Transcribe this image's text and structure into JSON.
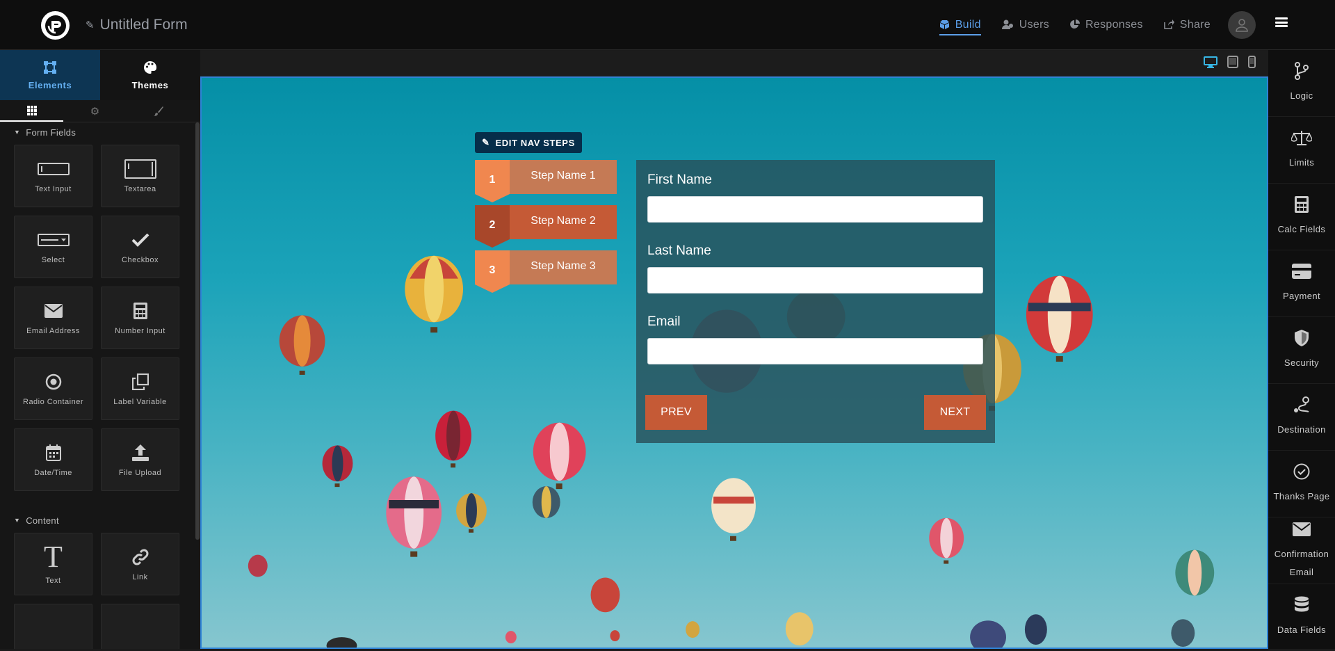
{
  "header": {
    "form_title": "Untitled Form",
    "nav": [
      {
        "label": "Build",
        "icon": "cubes-icon",
        "active": true
      },
      {
        "label": "Users",
        "icon": "users-icon",
        "active": false
      },
      {
        "label": "Responses",
        "icon": "pie-chart-icon",
        "active": false
      },
      {
        "label": "Share",
        "icon": "share-icon",
        "active": false
      }
    ]
  },
  "left_panel": {
    "tabs": [
      {
        "label": "Elements",
        "icon": "vector-square-icon",
        "active": true
      },
      {
        "label": "Themes",
        "icon": "palette-icon",
        "active": false
      }
    ],
    "subtabs": [
      "grid-icon",
      "gear-icon",
      "brush-icon"
    ],
    "sections": [
      {
        "title": "Form Fields",
        "items": [
          {
            "label": "Text Input",
            "icon": "text-input-icon"
          },
          {
            "label": "Textarea",
            "icon": "textarea-icon"
          },
          {
            "label": "Select",
            "icon": "select-icon"
          },
          {
            "label": "Checkbox",
            "icon": "check-icon"
          },
          {
            "label": "Email Address",
            "icon": "envelope-icon"
          },
          {
            "label": "Number Input",
            "icon": "calculator-icon"
          },
          {
            "label": "Radio Container",
            "icon": "radio-icon"
          },
          {
            "label": "Label Variable",
            "icon": "clone-icon"
          },
          {
            "label": "Date/Time",
            "icon": "calendar-icon"
          },
          {
            "label": "File Upload",
            "icon": "upload-icon"
          }
        ]
      },
      {
        "title": "Content",
        "items": [
          {
            "label": "Text",
            "icon": "text-icon"
          },
          {
            "label": "Link",
            "icon": "link-icon"
          }
        ]
      }
    ]
  },
  "canvas": {
    "edit_nav_label": "EDIT NAV STEPS",
    "steps": [
      {
        "number": "1",
        "label": "Step Name 1",
        "num_color": "#f0874f",
        "label_color": "#c57a55"
      },
      {
        "number": "2",
        "label": "Step Name 2",
        "num_color": "#a8472a",
        "label_color": "#c55a36"
      },
      {
        "number": "3",
        "label": "Step Name 3",
        "num_color": "#f0874f",
        "label_color": "#c57a55"
      }
    ],
    "form": {
      "fields": [
        {
          "label": "First Name",
          "value": ""
        },
        {
          "label": "Last Name",
          "value": ""
        },
        {
          "label": "Email",
          "value": ""
        }
      ],
      "prev_label": "PREV",
      "next_label": "NEXT"
    },
    "accent": "#c55a36"
  },
  "right_panel": {
    "items": [
      {
        "label": "Logic",
        "icon": "code-branch-icon"
      },
      {
        "label": "Limits",
        "icon": "balance-scale-icon"
      },
      {
        "label": "Calc Fields",
        "icon": "calculator-icon"
      },
      {
        "label": "Payment",
        "icon": "credit-card-icon"
      },
      {
        "label": "Security",
        "icon": "shield-icon"
      },
      {
        "label": "Destination",
        "icon": "route-icon"
      },
      {
        "label": "Thanks Page",
        "icon": "check-circle-icon"
      },
      {
        "label": "Confirmation Email",
        "icon": "envelope-icon"
      },
      {
        "label": "Data Fields",
        "icon": "database-icon"
      }
    ]
  }
}
